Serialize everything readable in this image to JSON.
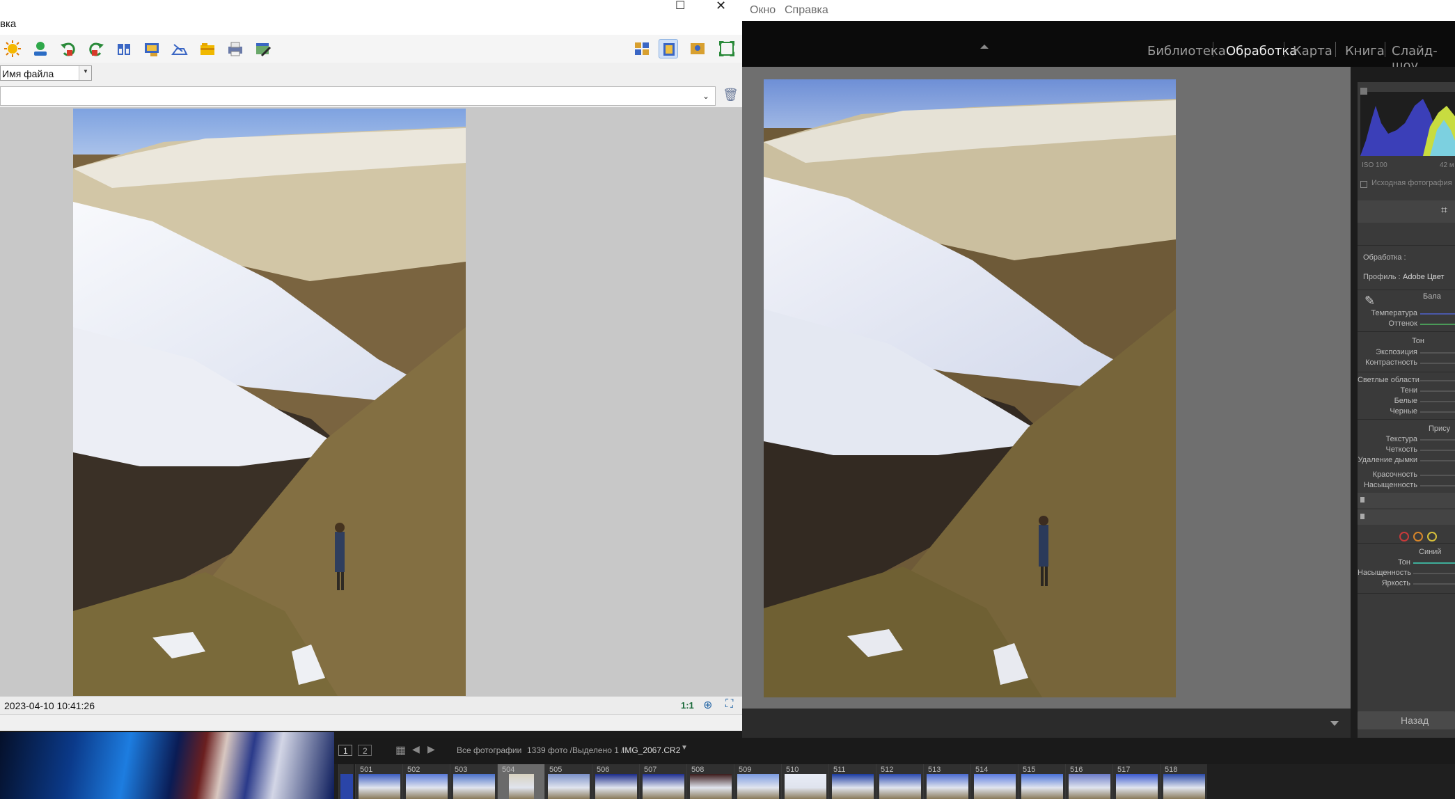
{
  "viewer": {
    "menu_fragment": "вка",
    "sort": {
      "selected": "Имя файла"
    },
    "path": {
      "value": ""
    },
    "status": {
      "datetime": "2023-04-10 10:41:26",
      "zoom": "1:1"
    },
    "toolbar_icons": [
      "sun-icon",
      "user-icon",
      "rotate-left-icon",
      "rotate-right-icon",
      "compare-icon",
      "slideshow-icon",
      "scan-icon",
      "folder-icon",
      "print-icon",
      "edit-icon"
    ],
    "view_icons": [
      "thumbnails-view-icon",
      "preview-view-icon",
      "image-view-icon",
      "fullscreen-icon"
    ]
  },
  "lightroom": {
    "menu": [
      "Окно",
      "Справка"
    ],
    "modules": [
      "Библиотека",
      "Обработка",
      "Карта",
      "Книга",
      "Слайд-шоу"
    ],
    "active_module": "Обработка",
    "panel": {
      "histogram_iso": "ISO 100",
      "histogram_focal": "42 м",
      "original_photo_label": "Исходная фотография",
      "treatment_label": "Обработка :",
      "profile_label": "Профиль :",
      "profile_value": "Adobe Цвет",
      "wb_header": "Бала",
      "temperature": "Температура",
      "tint": "Оттенок",
      "tone_header": "Тон",
      "exposure": "Экспозиция",
      "contrast": "Контрастность",
      "highlights": "Светлые области",
      "shadows": "Тени",
      "whites": "Белые",
      "blacks": "Черные",
      "presence_header": "Прису",
      "texture": "Текстура",
      "clarity": "Четкость",
      "dehaze": "Удаление дымки",
      "vibrance": "Красочность",
      "saturation": "Насыщенность",
      "hsl_color": "Синий",
      "hsl_hue": "Тон",
      "hsl_saturation": "Насыщенность",
      "hsl_luminance": "Яркость",
      "back_button": "Назад"
    },
    "filmstrip": {
      "page1": "1",
      "page2": "2",
      "source": "Все фотографии",
      "count": "1339 фото /",
      "selected": "Выделено 1 /",
      "filename": "IMG_2067.CR2",
      "cells": [
        "501",
        "502",
        "503",
        "504",
        "505",
        "506",
        "507",
        "508",
        "509",
        "510",
        "511",
        "512",
        "513",
        "514",
        "515",
        "516",
        "517",
        "518"
      ]
    }
  }
}
